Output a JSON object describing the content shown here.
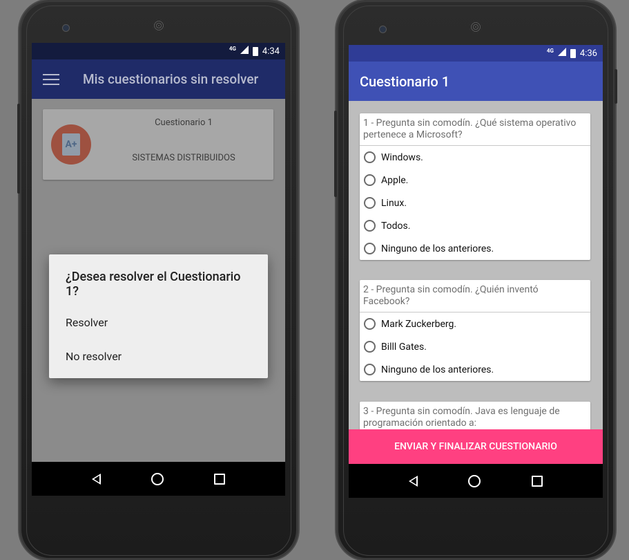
{
  "left": {
    "status_time": "4:34",
    "network": "4G",
    "appbar_title": "Mis cuestionarios sin resolver",
    "card": {
      "title": "Cuestionario 1",
      "subject": "SISTEMAS DISTRIBUIDOS",
      "icon_label": "A+"
    },
    "dialog": {
      "title": "¿Desea resolver el Cuestionario 1?",
      "options": [
        "Resolver",
        "No resolver"
      ]
    }
  },
  "right": {
    "status_time": "4:36",
    "network": "4G",
    "appbar_title": "Cuestionario 1",
    "questions": [
      {
        "text": "1 - Pregunta sin comodín.  ¿Qué sistema operativo pertenece a Microsoft?",
        "options": [
          "Windows.",
          "Apple.",
          "Linux.",
          "Todos.",
          "Ninguno de los anteriores."
        ]
      },
      {
        "text": "2 - Pregunta sin comodín. ¿Quién inventó Facebook?",
        "options": [
          "Mark Zuckerberg.",
          "Billl Gates.",
          "Ninguno de los anteriores."
        ]
      },
      {
        "text": "3 - Pregunta sin comodín. Java es lenguaje de programación orientado a:",
        "options": []
      }
    ],
    "submit_label": "ENVIAR Y FINALIZAR CUESTIONARIO"
  },
  "icons": {
    "menu": "hamburger-menu-icon",
    "back": "back-triangle-icon",
    "home": "home-circle-icon",
    "recents": "recents-square-icon",
    "radio": "radio-unchecked-icon"
  }
}
